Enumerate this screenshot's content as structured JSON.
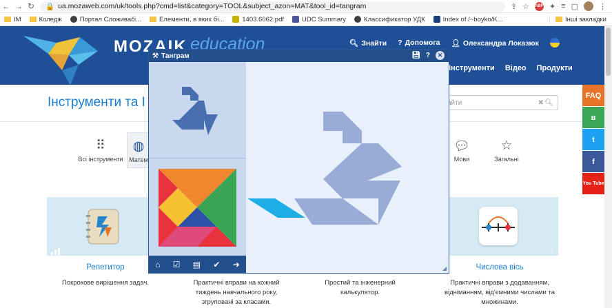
{
  "browser": {
    "url": "ua.mozaweb.com/uk/tools.php?cmd=list&category=TOOL&subject_azon=MAT&tool_id=tangram",
    "bookmarks": [
      {
        "label": "IM",
        "type": "folder"
      },
      {
        "label": "Коледж",
        "type": "folder"
      },
      {
        "label": "Портал Сложиваčі...",
        "type": "site",
        "color": "#3c4043"
      },
      {
        "label": "Елементи, в яких бі...",
        "type": "folder"
      },
      {
        "label": "1403.6062.pdf",
        "type": "site",
        "color": "#c8b400"
      },
      {
        "label": "UDC Summary",
        "type": "site",
        "color": "#4b55a1"
      },
      {
        "label": "Классификатор УДК",
        "type": "site",
        "color": "#3c4043"
      },
      {
        "label": "Index of /~boyko/K...",
        "type": "site",
        "color": "#1a3d7c"
      }
    ],
    "other_bookmarks": "Інші закладки"
  },
  "site": {
    "logo": "MOZAIK",
    "logo_suffix": "education",
    "top_nav": [
      "Знайти",
      "Допомога",
      "Олександра Локазюк"
    ],
    "main_nav": [
      "Інструменти",
      "Відео",
      "Продукти"
    ],
    "page_title": "Інструменти та І",
    "search_placeholder": "айти",
    "categories": [
      {
        "label": "Всі інструменти",
        "icon": "grid-icon"
      },
      {
        "label": "Матем",
        "icon": "globe-icon"
      },
      {
        "label": "Мови",
        "icon": "speech-icon"
      },
      {
        "label": "Загальні",
        "icon": "star-icon"
      }
    ],
    "cards": [
      {
        "title": "Репетитор",
        "desc": "Покрокове вирішення задач."
      },
      {
        "title": "",
        "desc": "Практичні вправи на кожний тиждень навчального року, згруповані за класами."
      },
      {
        "title": "",
        "desc": "Простий та інженерний калькулятор."
      },
      {
        "title": "Числова вісь",
        "desc": "Практичні вправи з додаванням, відніманням, від'ємними числами та множинами."
      }
    ],
    "social": [
      {
        "label": "FAQ",
        "color": "#e8742a"
      },
      {
        "label": "ʙ",
        "color": "#3aa757"
      },
      {
        "label": "t",
        "color": "#1da1f2"
      },
      {
        "label": "f",
        "color": "#3b5998"
      },
      {
        "label": "You Tube",
        "color": "#e62117"
      }
    ]
  },
  "dialog": {
    "title": "Тангpам",
    "colors": {
      "header": "#234f8c",
      "shape_outline": "#4a6fb1",
      "target_shape": "#98acd6",
      "cyan_piece": "#1eaee6"
    },
    "pieces": [
      {
        "name": "red-triangle",
        "color": "#e8333c"
      },
      {
        "name": "orange-triangle",
        "color": "#f0862e"
      },
      {
        "name": "green-triangle",
        "color": "#3aa655"
      },
      {
        "name": "yellow-square",
        "color": "#f6c231"
      },
      {
        "name": "purple-triangle",
        "color": "#8c3fae"
      },
      {
        "name": "blue-triangle",
        "color": "#2e51a8"
      },
      {
        "name": "pink-parallelogram",
        "color": "#e04a7b"
      }
    ]
  }
}
